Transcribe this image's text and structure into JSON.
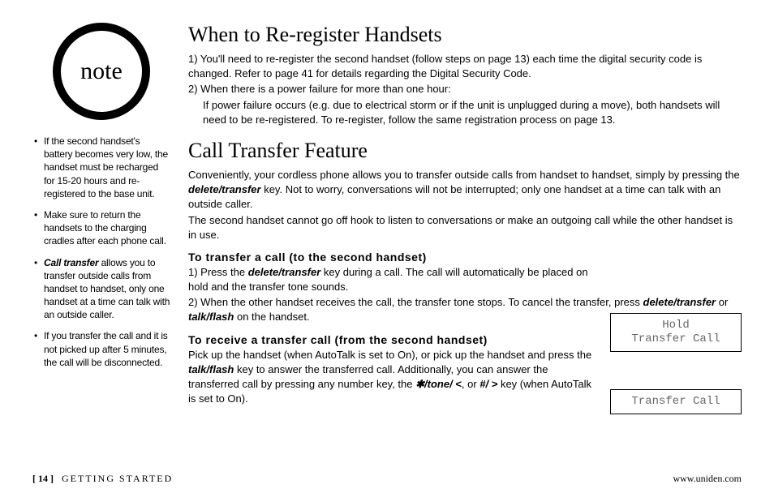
{
  "note_label": "note",
  "sidebar_bullets": [
    {
      "text": "If the second handset's battery becomes very low, the handset must be recharged for 15-20 hours and re-registered to the base unit."
    },
    {
      "text": "Make sure to return the handsets to the charging cradles after each phone call."
    },
    {
      "lead": "Call transfer",
      "text": " allows you to transfer outside calls from handset to handset, only one handset at a time can talk with an outside caller."
    },
    {
      "text": "If you transfer the call and it is not picked up after 5 minutes, the call will be disconnected."
    }
  ],
  "heading1": "When to Re-register Handsets",
  "h1_item1": "1) You'll need to re-register the second handset (follow steps on page 13) each time the digital security code is changed. Refer to page 41 for details regarding the Digital Security Code.",
  "h1_item2a": "2) When there is a power failure for more than one hour:",
  "h1_item2b": "If power failure occurs (e.g. due to electrical storm or if the unit is unplugged during a move), both handsets will need to be re-registered. To re-register, follow the same registration process on page 13.",
  "heading2": "Call Transfer Feature",
  "h2_intro_a": "Conveniently, your cordless phone allows you to transfer outside calls from handset to handset, simply by pressing the ",
  "h2_intro_key": "delete/transfer",
  "h2_intro_b": " key. Not to worry, conversations will not be interrupted; only one handset at a time can talk with an outside caller.",
  "h2_intro_c": "The second handset cannot go off hook to listen to conversations or make an outgoing call while the other handset is in use.",
  "sub1": "To transfer a call (to the second handset)",
  "s1_l1a": "1) Press the ",
  "s1_l1_key": "delete/transfer",
  "s1_l1b": " key during a call. The call will automatically be placed on hold and the transfer tone sounds.",
  "s1_l2a": "2) When the other handset receives the call, the transfer tone stops. To cancel the transfer, press ",
  "s1_l2_key1": "delete/transfer",
  "s1_l2_mid": " or ",
  "s1_l2_key2": "talk/flash",
  "s1_l2b": " on the handset.",
  "sub2": "To receive a transfer call (from the second handset)",
  "s2_a": "Pick up the handset (when AutoTalk is set to On), or pick up the handset and press the ",
  "s2_key": "talk/flash",
  "s2_b": " key to answer the transferred call. Additionally, you can answer the transferred call by pressing any number key, the ",
  "s2_key2": "✱/tone/ <",
  "s2_mid": ", or ",
  "s2_key3": "#/ >",
  "s2_c": " key (when AutoTalk is set to On).",
  "display1_line1": "Hold",
  "display1_line2": "Transfer Call",
  "display2": "Transfer Call",
  "footer_page": "[ 14 ]",
  "footer_section": "GETTING STARTED",
  "footer_url": "www.uniden.com"
}
